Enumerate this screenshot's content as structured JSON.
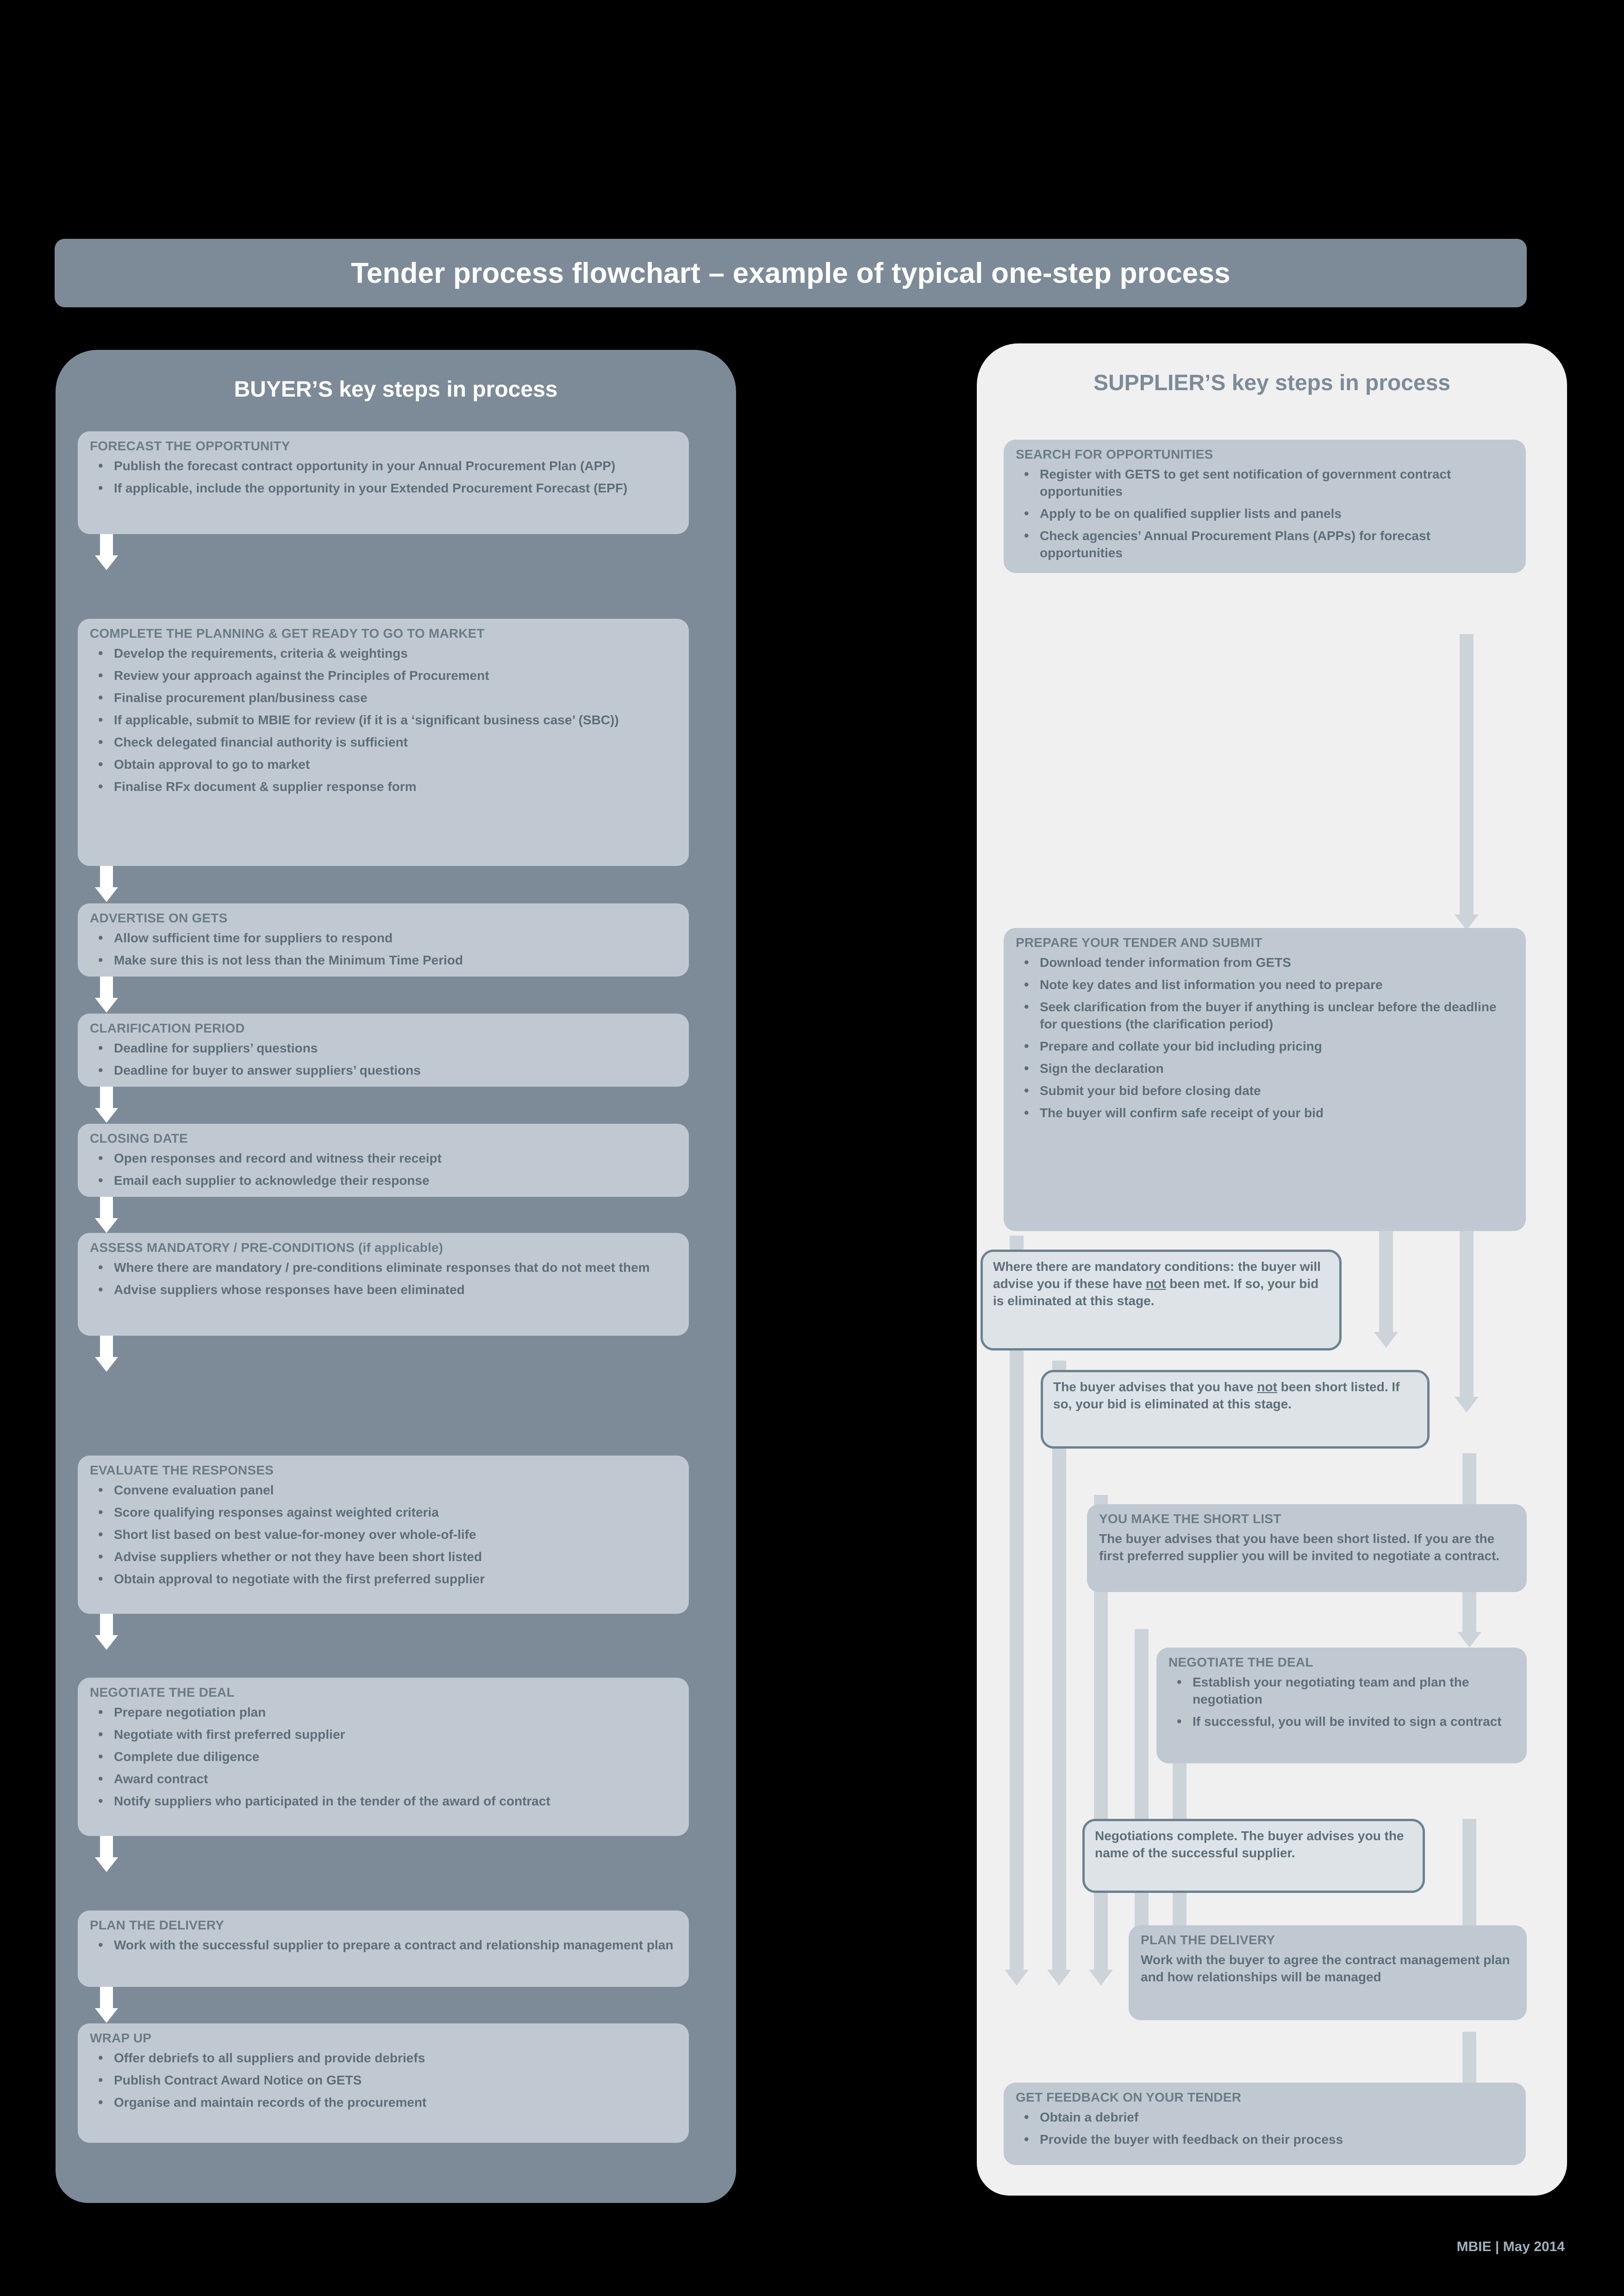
{
  "title": "Tender process flowchart – example of typical one-step process",
  "footer": "MBIE | May 2014",
  "colors": {
    "page_background": "#000000",
    "title_bar": "#7c8b97",
    "buyer_panel": "#7c8b97",
    "supplier_panel": "#f0f0f0",
    "step_box": "#c0c9d1",
    "callout_box_fill": "#dde3e7",
    "callout_box_border": "#6c8291",
    "text": "#5d6e7a",
    "buyer_arrow": "#ffffff",
    "supplier_arrow": "#ccd4da"
  },
  "buyer": {
    "heading": "BUYER’S key steps in process",
    "steps": [
      {
        "title": "FORECAST THE OPPORTUNITY",
        "bullets": [
          "Publish the forecast contract opportunity in your Annual Procurement Plan (APP)",
          "If applicable, include the opportunity in your Extended Procurement Forecast (EPF)"
        ]
      },
      {
        "title": "COMPLETE THE PLANNING & GET READY TO GO TO MARKET",
        "bullets": [
          "Develop the requirements, criteria & weightings",
          "Review your approach against the Principles of Procurement",
          "Finalise procurement plan/business case",
          "If applicable, submit to MBIE for review (if it is a ‘significant business case’ (SBC))",
          "Check delegated financial authority is sufficient",
          "Obtain approval to go to market",
          "Finalise RFx document & supplier response form"
        ]
      },
      {
        "title": "ADVERTISE ON GETS",
        "bullets": [
          "Allow sufficient time for suppliers to respond",
          "Make sure this is not less than the Minimum Time Period"
        ]
      },
      {
        "title": "CLARIFICATION PERIOD",
        "bullets": [
          "Deadline for suppliers’ questions",
          "Deadline for buyer to answer suppliers’ questions"
        ]
      },
      {
        "title": "CLOSING DATE",
        "bullets": [
          "Open responses and record and witness their receipt",
          "Email each supplier to acknowledge their response"
        ]
      },
      {
        "title": "ASSESS MANDATORY / PRE-CONDITIONS (if applicable)",
        "bullets": [
          "Where there are mandatory / pre-conditions eliminate responses that do not meet them",
          "Advise suppliers whose responses have been eliminated"
        ]
      },
      {
        "title": "EVALUATE THE RESPONSES",
        "bullets": [
          "Convene evaluation panel",
          "Score qualifying responses against weighted criteria",
          "Short list based on best value-for-money over whole-of-life",
          "Advise suppliers whether or not they have been short listed",
          "Obtain approval to negotiate with the first preferred supplier"
        ]
      },
      {
        "title": "NEGOTIATE THE DEAL",
        "bullets": [
          "Prepare negotiation plan",
          "Negotiate with first preferred supplier",
          "Complete due diligence",
          "Award contract",
          "Notify suppliers who participated in the tender of the award of contract"
        ]
      },
      {
        "title": "PLAN THE DELIVERY",
        "bullets": [
          "Work with the successful supplier to prepare a contract and relationship management plan"
        ]
      },
      {
        "title": "WRAP UP",
        "bullets": [
          "Offer debriefs to all suppliers and provide debriefs",
          "Publish Contract Award Notice on GETS",
          "Organise and maintain records of the procurement"
        ]
      }
    ]
  },
  "supplier": {
    "heading": "SUPPLIER’S key steps in process",
    "steps": [
      {
        "title": "SEARCH FOR OPPORTUNITIES",
        "bullets": [
          "Register with GETS to get sent notification of government contract opportunities",
          "Apply to be on qualified supplier lists and panels",
          "Check agencies’ Annual Procurement Plans (APPs) for forecast opportunities"
        ]
      },
      {
        "title": "PREPARE YOUR TENDER AND SUBMIT",
        "bullets": [
          "Download tender information from GETS",
          "Note key dates and list information you need to prepare",
          "Seek clarification from the buyer if anything is unclear before the deadline for questions (the clarification period)",
          "Prepare and collate your bid including pricing",
          "Sign the declaration",
          "Submit your bid before closing date",
          "The buyer will confirm safe receipt of your bid"
        ]
      }
    ],
    "callout_mandatory": {
      "text_before": "Where there are mandatory conditions: the buyer will advise you if these have ",
      "emphasis": "not",
      "text_after": " been met. If so, your bid is eliminated at this stage."
    },
    "callout_shortlist": {
      "text_before": "The buyer advises that you have ",
      "emphasis": "not",
      "text_after": " been short listed. If so, your bid is eliminated at this stage."
    },
    "short_list": {
      "title": "YOU MAKE THE SHORT LIST",
      "body": "The buyer advises that you have been short listed. If you are the first preferred supplier you will be invited to negotiate a contract."
    },
    "negotiate": {
      "title": "NEGOTIATE THE DEAL",
      "bullets": [
        "Establish your negotiating team and plan the negotiation",
        "If successful, you will be invited to sign a contract"
      ]
    },
    "callout_complete": {
      "text": "Negotiations complete. The buyer advises you the name of the successful supplier."
    },
    "plan_delivery": {
      "title": "PLAN THE DELIVERY",
      "body": "Work with the buyer to agree the contract management plan and how relationships will be managed"
    },
    "feedback": {
      "title": "GET FEEDBACK ON YOUR TENDER",
      "bullets": [
        "Obtain a debrief",
        "Provide the buyer with feedback on their process"
      ]
    }
  }
}
